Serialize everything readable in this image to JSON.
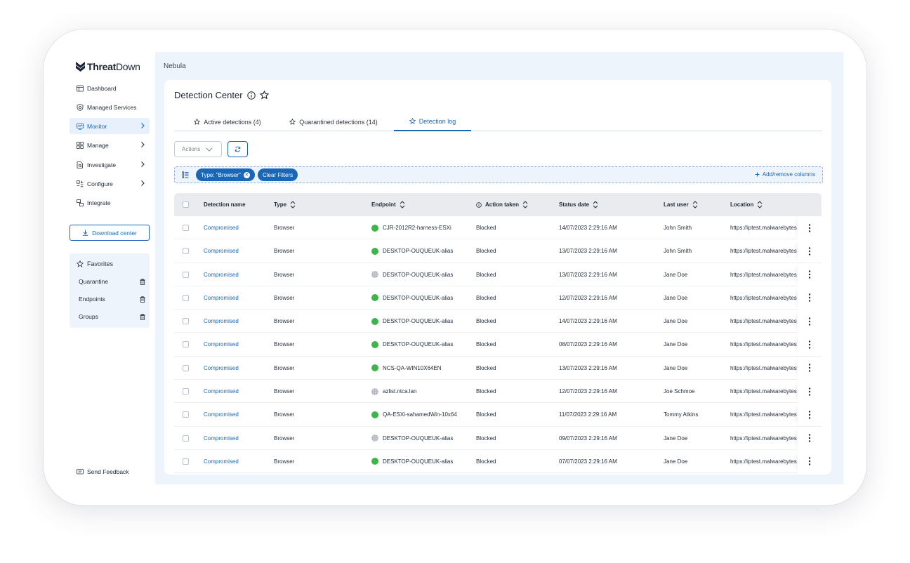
{
  "sidebar": {
    "logo": {
      "bold": "Threat",
      "rest": "Down"
    },
    "items": [
      {
        "label": "Dashboard",
        "icon": "dashboard-icon",
        "chevron": false,
        "active": false
      },
      {
        "label": "Managed Services",
        "icon": "shield-icon",
        "chevron": false,
        "active": false
      },
      {
        "label": "Monitor",
        "icon": "monitor-icon",
        "chevron": true,
        "active": true
      },
      {
        "label": "Manage",
        "icon": "grid-icon",
        "chevron": true,
        "active": false
      },
      {
        "label": "Investigate",
        "icon": "search-doc-icon",
        "chevron": true,
        "active": false
      },
      {
        "label": "Configure",
        "icon": "config-icon",
        "chevron": true,
        "active": false
      },
      {
        "label": "Integrate",
        "icon": "integrate-icon",
        "chevron": false,
        "active": false
      }
    ],
    "download_label": "Download center",
    "favorites": {
      "title": "Favorites",
      "items": [
        "Quarantine",
        "Endpoints",
        "Groups"
      ]
    },
    "feedback_label": "Send Feedback"
  },
  "header": {
    "brand": "Nebula"
  },
  "page": {
    "title": "Detection Center",
    "tabs": [
      {
        "label": "Active detections (4)",
        "active": false
      },
      {
        "label": "Quarantined detections (14)",
        "active": false
      },
      {
        "label": "Detection log",
        "active": true
      }
    ],
    "actions_label": "Actions",
    "filter": {
      "chip_label": "Type: \"Browser\"",
      "clear_label": "Clear Filters",
      "add_columns_label": "Add/remove columns"
    }
  },
  "table": {
    "columns": [
      "Detection name",
      "Type",
      "Endpoint",
      "Action taken",
      "Status date",
      "Last user",
      "Location"
    ],
    "rows": [
      {
        "name": "Compromised",
        "type": "Browser",
        "endpoint": "CJR-2012R2-harness-ESXi",
        "online": true,
        "action": "Blocked",
        "date": "14/07/2023 2:29:16 AM",
        "user": "John Smith",
        "location": "https://iptest.malwarebytes"
      },
      {
        "name": "Compromised",
        "type": "Browser",
        "endpoint": "DESKTOP-OUQUEUK-alias",
        "online": true,
        "action": "Blocked",
        "date": "13/07/2023 2:29:16 AM",
        "user": "John Smith",
        "location": "https://iptest.malwarebytes"
      },
      {
        "name": "Compromised",
        "type": "Browser",
        "endpoint": "DESKTOP-OUQUEUK-alias",
        "online": false,
        "action": "Blocked",
        "date": "13/07/2023 2:29:16 AM",
        "user": "Jane Doe",
        "location": "https://iptest.malwarebytes"
      },
      {
        "name": "Compromised",
        "type": "Browser",
        "endpoint": "DESKTOP-OUQUEUK-alias",
        "online": true,
        "action": "Blocked",
        "date": "12/07/2023 2:29:16 AM",
        "user": "Jane Doe",
        "location": "https://iptest.malwarebytes"
      },
      {
        "name": "Compromised",
        "type": "Browser",
        "endpoint": "DESKTOP-OUQUEUK-alias",
        "online": true,
        "action": "Blocked",
        "date": "14/07/2023 2:29:16 AM",
        "user": "Jane Doe",
        "location": "https://iptest.malwarebytes"
      },
      {
        "name": "Compromised",
        "type": "Browser",
        "endpoint": "DESKTOP-OUQUEUK-alias",
        "online": true,
        "action": "Blocked",
        "date": "08/07/2023 2:29:16 AM",
        "user": "Jane Doe",
        "location": "https://iptest.malwarebytes"
      },
      {
        "name": "Compromised",
        "type": "Browser",
        "endpoint": "NCS-QA-WIN10X64EN",
        "online": true,
        "action": "Blocked",
        "date": "13/07/2023 2:29:16 AM",
        "user": "Jane Doe",
        "location": "https://iptest.malwarebytes"
      },
      {
        "name": "Compromised",
        "type": "Browser",
        "endpoint": "azlist.ntca.lan",
        "online": false,
        "action": "Blocked",
        "date": "12/07/2023 2:29:16 AM",
        "user": "Joe Schmoe",
        "location": "https://iptest.malwarebytes"
      },
      {
        "name": "Compromised",
        "type": "Browser",
        "endpoint": "QA-ESXi-sahamedWin-10x64",
        "online": true,
        "action": "Blocked",
        "date": "11/07/2023 2:29:16 AM",
        "user": "Tommy Atkins",
        "location": "https://iptest.malwarebytes"
      },
      {
        "name": "Compromised",
        "type": "Browser",
        "endpoint": "DESKTOP-OUQUEUK-alias",
        "online": false,
        "action": "Blocked",
        "date": "09/07/2023 2:29:16 AM",
        "user": "Jane Doe",
        "location": "https://iptest.malwarebytes"
      },
      {
        "name": "Compromised",
        "type": "Browser",
        "endpoint": "DESKTOP-OUQUEUK-alias",
        "online": true,
        "action": "Blocked",
        "date": "07/07/2023 2:29:16 AM",
        "user": "Jane Doe",
        "location": "https://iptest.malwarebytes"
      }
    ]
  },
  "colors": {
    "accent": "#1a67b8",
    "online": "#3db549",
    "offline": "#c9cdd3",
    "panel": "#eef4fc"
  }
}
